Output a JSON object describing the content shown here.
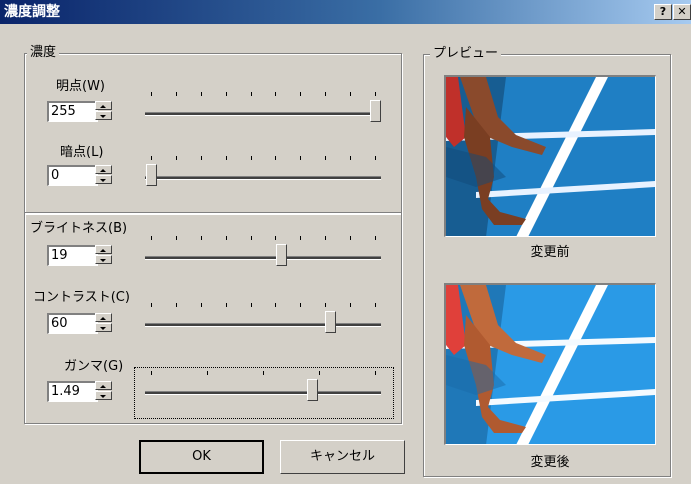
{
  "window": {
    "title": "濃度調整",
    "help_label": "?",
    "close_label": "✕",
    "icons": [
      "help-icon",
      "close-icon"
    ]
  },
  "density_group": {
    "legend": "濃度",
    "highlight": {
      "label": "明点(W)",
      "value": "255",
      "level": 1.0,
      "ticks": 10
    },
    "shadow": {
      "label": "暗点(L)",
      "value": "0",
      "level": 0.0,
      "ticks": 10
    }
  },
  "adjust_group": {
    "brightness": {
      "label": "ブライトネス(B)",
      "value": "19",
      "level": 0.58,
      "ticks": 10
    },
    "contrast": {
      "label": "コントラスト(C)",
      "value": "60",
      "level": 0.8,
      "ticks": 10
    },
    "gamma": {
      "label": "ガンマ(G)",
      "value": "1.49",
      "level": 0.72,
      "ticks": 5
    }
  },
  "buttons": {
    "ok": "OK",
    "cancel": "キャンセル"
  },
  "preview": {
    "legend": "プレビュー",
    "before_caption": "変更前",
    "after_caption": "変更後"
  },
  "colors": {
    "title_bar": "#0a246a",
    "dialog_face": "#d4d0c8",
    "track_blue_before": "#1f7fc4",
    "track_blue_after": "#2a9ae6",
    "skin_before": "#8a4a2c",
    "skin_after": "#c06a3c"
  }
}
